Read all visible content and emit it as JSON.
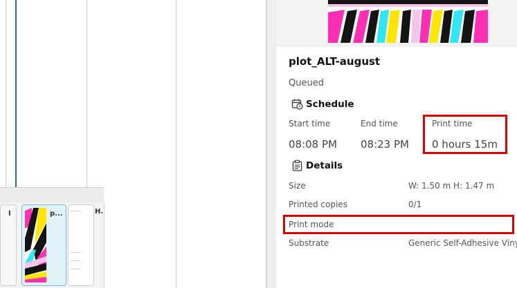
{
  "timeline": {
    "cards": [
      {
        "label": "I"
      },
      {
        "label": "p..."
      },
      {
        "label": "H."
      }
    ]
  },
  "job": {
    "name": "plot_ALT-august",
    "status": "Queued"
  },
  "schedule": {
    "heading": "Schedule",
    "start_label": "Start time",
    "start_value": "08:08 PM",
    "end_label": "End time",
    "end_value": "08:23 PM",
    "print_label": "Print time",
    "print_value": "0 hours 15m"
  },
  "details": {
    "heading": "Details",
    "rows": [
      {
        "label": "Size",
        "value": "W: 1.50 m  H: 1.47 m"
      },
      {
        "label": "Printed copies",
        "value": "0/1"
      },
      {
        "label": "Print mode",
        "value": ""
      },
      {
        "label": "Substrate",
        "value": "Generic Self-Adhesive Vinyl"
      }
    ]
  },
  "colors": {
    "highlight": "#e00000",
    "accent_blue": "#1f6fa8",
    "magenta": "#ff2fb4",
    "cyan": "#2fe6f2",
    "yellow": "#ffe600",
    "black": "#141414"
  }
}
